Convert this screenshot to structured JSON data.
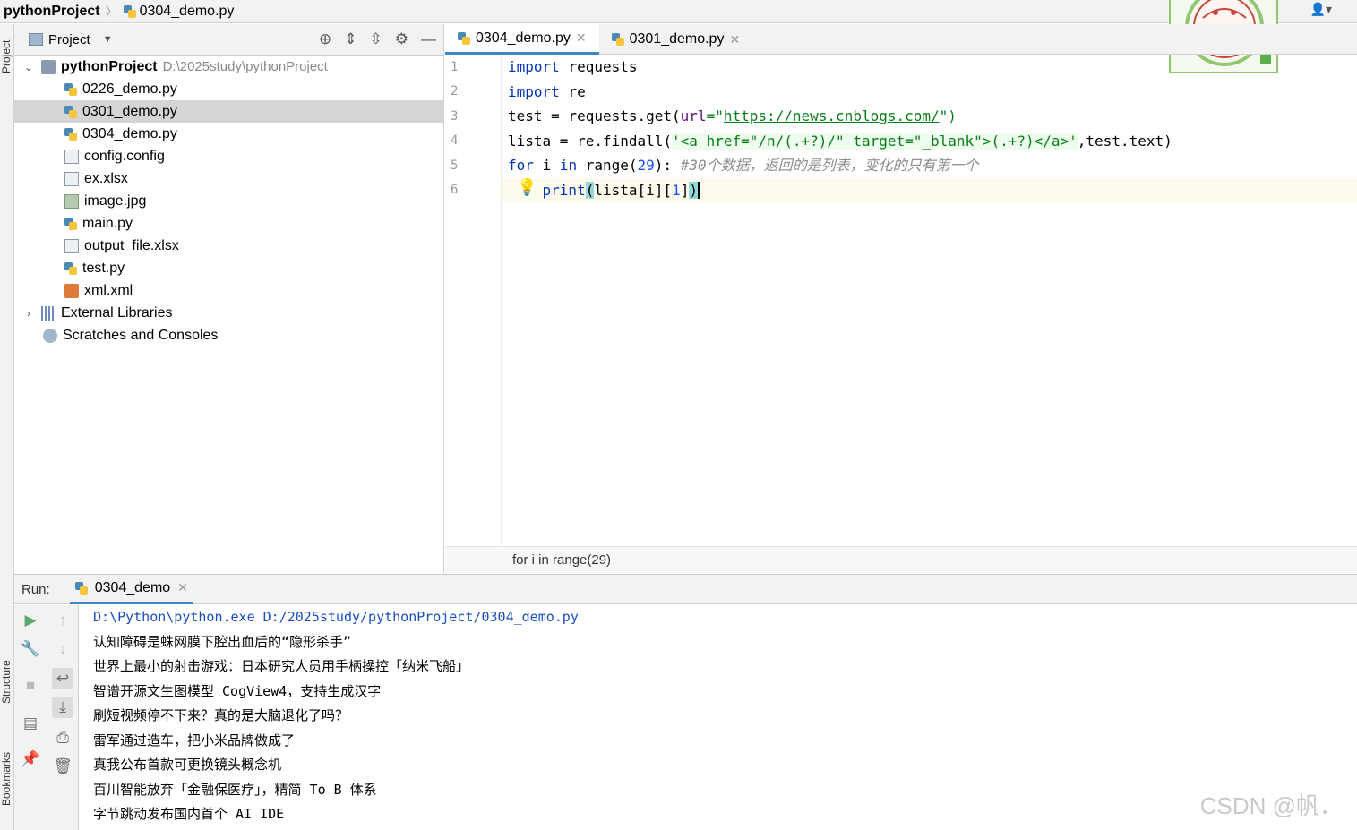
{
  "breadcrumb": {
    "project": "pythonProject",
    "file": "0304_demo.py"
  },
  "left_strip": {
    "project_label": "Project",
    "structure_label": "Structure",
    "bookmarks_label": "Bookmarks"
  },
  "project_panel": {
    "title": "Project",
    "root": {
      "name": "pythonProject",
      "path": "D:\\2025study\\pythonProject"
    },
    "files": [
      {
        "name": "0226_demo.py",
        "icon": "python-file-icon"
      },
      {
        "name": "0301_demo.py",
        "icon": "python-file-icon",
        "selected": true
      },
      {
        "name": "0304_demo.py",
        "icon": "python-file-icon"
      },
      {
        "name": "config.config",
        "icon": "text-file-icon"
      },
      {
        "name": "ex.xlsx",
        "icon": "unknown-file-icon"
      },
      {
        "name": "image.jpg",
        "icon": "image-file-icon"
      },
      {
        "name": "main.py",
        "icon": "python-file-icon"
      },
      {
        "name": "output_file.xlsx",
        "icon": "unknown-file-icon"
      },
      {
        "name": "test.py",
        "icon": "python-file-icon"
      },
      {
        "name": "xml.xml",
        "icon": "xml-file-icon"
      }
    ],
    "external_libraries": "External Libraries",
    "scratches": "Scratches and Consoles"
  },
  "editor": {
    "tabs": [
      {
        "label": "0304_demo.py",
        "active": true
      },
      {
        "label": "0301_demo.py",
        "active": false
      }
    ],
    "line_numbers": [
      "1",
      "2",
      "3",
      "4",
      "5",
      "6"
    ],
    "code": {
      "l1_kw": "import",
      "l1_rest": " requests",
      "l2_kw": "import",
      "l2_rest": " re",
      "l3_a": "test = requests.get(",
      "l3_param": "url",
      "l3_b": "=\"",
      "l3_url": "https://news.cnblogs.com/",
      "l3_c": "\")",
      "l4_a": "lista = re.findall(",
      "l4_str": "'<a href=\"/n/(.+?)/\" target=\"_blank\">(.+?)</a>'",
      "l4_b": ",test.text)",
      "l5_for": "for",
      "l5_a": " i ",
      "l5_in": "in",
      "l5_b": " range(",
      "l5_num": "29",
      "l5_c": "): ",
      "l5_cmt": "#30个数据，返回的是列表，变化的只有第一个",
      "l6_indent": "    ",
      "l6_kw": "print",
      "l6_open": "(",
      "l6_a": "lista[i][",
      "l6_num": "1",
      "l6_b": "]",
      "l6_close": ")"
    },
    "breadcrumb": "for i in range(29)"
  },
  "run": {
    "label": "Run:",
    "tab": "0304_demo",
    "output": [
      "D:\\Python\\python.exe D:/2025study/pythonProject/0304_demo.py",
      "认知障碍是蛛网膜下腔出血后的“隐形杀手”",
      "世界上最小的射击游戏：日本研究人员用手柄操控「纳米飞船」",
      "智谱开源文生图模型 CogView4，支持生成汉字",
      "刷短视频停不下来？真的是大脑退化了吗？",
      "雷军通过造车，把小米品牌做成了",
      "真我公布首款可更换镜头概念机",
      "百川智能放弃「金融保医疗」，精简 To B 体系",
      "字节跳动发布国内首个 AI IDE"
    ]
  },
  "watermark": "CSDN @帆．",
  "colors": {
    "keyword": "#0033b3",
    "string": "#067d17",
    "number": "#1750eb",
    "comment": "#8c8c8c",
    "accent": "#4083c9"
  }
}
